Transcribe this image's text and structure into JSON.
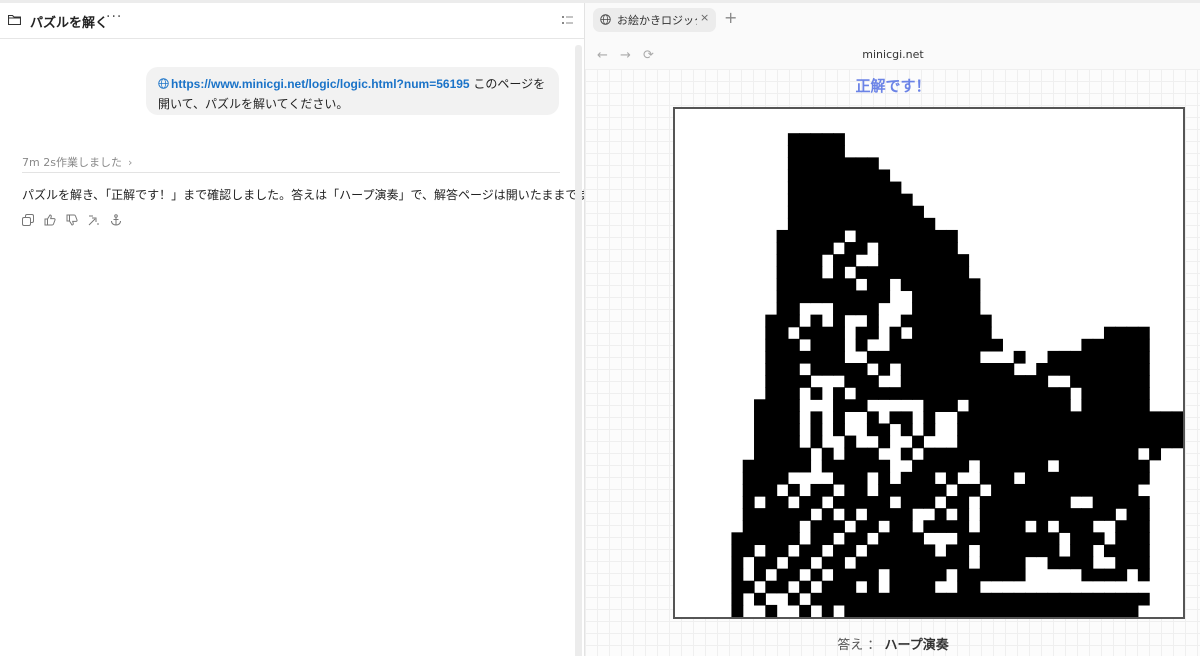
{
  "chat": {
    "title": "パズルを解く",
    "more": "···",
    "user_message": {
      "url": "https://www.minicgi.net/logic/logic.html?num=56195",
      "text": " このページを開いて、パズルを解いてください。"
    },
    "worked": "7m 2s作業しました",
    "answer": "パズルを解き、「正解です！」まで確認しました。答えは「ハープ演奏」で、解答ページは開いたままです。"
  },
  "browser": {
    "tab_label": "お絵かきロジック",
    "tab_close": "×",
    "new_tab": "+",
    "back": "←",
    "forward": "→",
    "reload": "⟳",
    "host": "minicgi.net"
  },
  "puzzle": {
    "status": "正解です！",
    "answer_label": "答え ：",
    "answer_value": "ハープ演奏",
    "rows": [
      "..........................................",
      "..........................................",
      "..........#####...........................",
      "..........#####...........................",
      "..........########........................",
      "..........#########.......................",
      "..........##########......................",
      "..........###########.....................",
      "..........############....................",
      "..........#############...................",
      ".........######.#########.................",
      ".........#####.##.#######.................",
      ".........####.##..########................",
      ".........####.#.##########................",
      ".........#######.##.#######...............",
      ".........##########..######...............",
      ".........##...####...######...............",
      "........###.#.#..#..########..............",
      "........##.####.##.#.#######..........####",
      "........###.###.#..##########.......######",
      "........#######..##########...#..#########",
      "........###.#####.#.##########..##########",
      "........####...###..#############..#######",
      "........###.#.#.###################.######",
      ".......####...###.....###.#########.######",
      ".......####.#.#..#.##.#..####################",
      ".......####.#.#..##.#.#..####################",
      ".......####.#..#..#..#...####################",
      ".......#####.#.###..#.###################.#",
      "......######.######..#####.######.########",
      "......####....###.#.###.#..###.###########",
      "......###.#.##.##.######.##.#############.",
      "......#.##.##.#####.###.##.########..#####",
      "......######.#.#.####..#.#.############.##",
      "......#####.###.##.##.####.####.#.###..###",
      ".....######.##.##.####...#########.###.###",
      ".....##.##.##.##.######.##.#######.##.####",
      ".....#.##.##.##.##########.####..####..###",
      ".....#.#.##.#.####.#####.######.....####.#",
      ".....##.##.#.###.#.####..##...............",
      ".....#.#..#.##############################",
      ".....#..#..#.#.##########################."
    ]
  }
}
